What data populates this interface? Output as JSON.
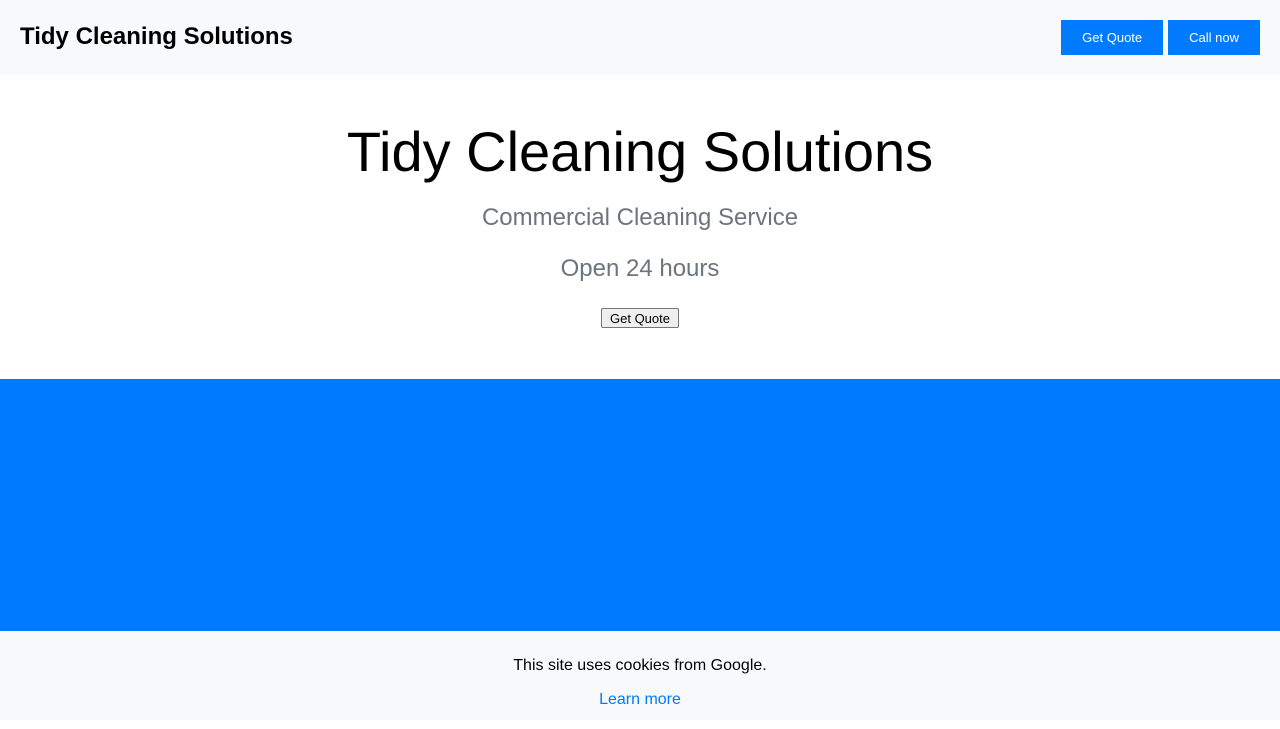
{
  "header": {
    "brand": "Tidy Cleaning Solutions",
    "get_quote_label": "Get Quote",
    "call_now_label": "Call now"
  },
  "hero": {
    "title": "Tidy Cleaning Solutions",
    "subtitle": "Commercial Cleaning Service",
    "hours": "Open 24 hours",
    "button_label": "Get Quote"
  },
  "cookie": {
    "message": "This site uses cookies from Google.",
    "link_label": "Learn more"
  },
  "colors": {
    "accent": "#007bff",
    "bar_background": "#f8f9fa",
    "muted_text": "#6c757d"
  }
}
